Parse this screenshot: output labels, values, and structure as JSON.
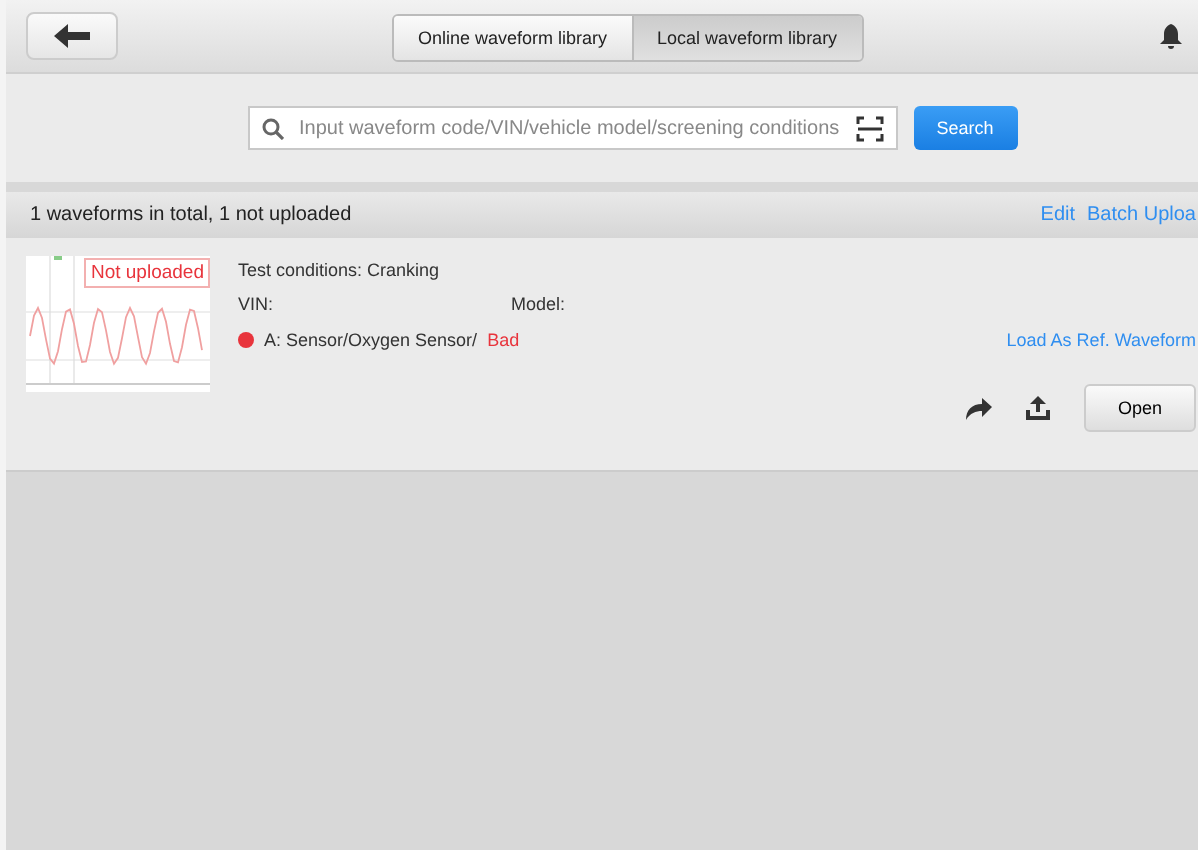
{
  "tabs": [
    {
      "label": "Online waveform library",
      "selected": false
    },
    {
      "label": "Local waveform library",
      "selected": true
    }
  ],
  "search": {
    "placeholder": "Input waveform code/VIN/vehicle model/screening conditions",
    "button": "Search"
  },
  "summary": {
    "text": "1 waveforms in total, 1 not uploaded",
    "actions": [
      "Edit",
      "Batch Uploa"
    ]
  },
  "waveforms": [
    {
      "badge": "Not uploaded",
      "conditions": "Test conditions: Cranking",
      "vin": "VIN:",
      "model": "Model:",
      "channel": "A:  Sensor/Oxygen Sensor/",
      "result": "Bad",
      "color": "#e8343c",
      "load": "Load As Ref. Waveform",
      "open": "Open"
    }
  ]
}
